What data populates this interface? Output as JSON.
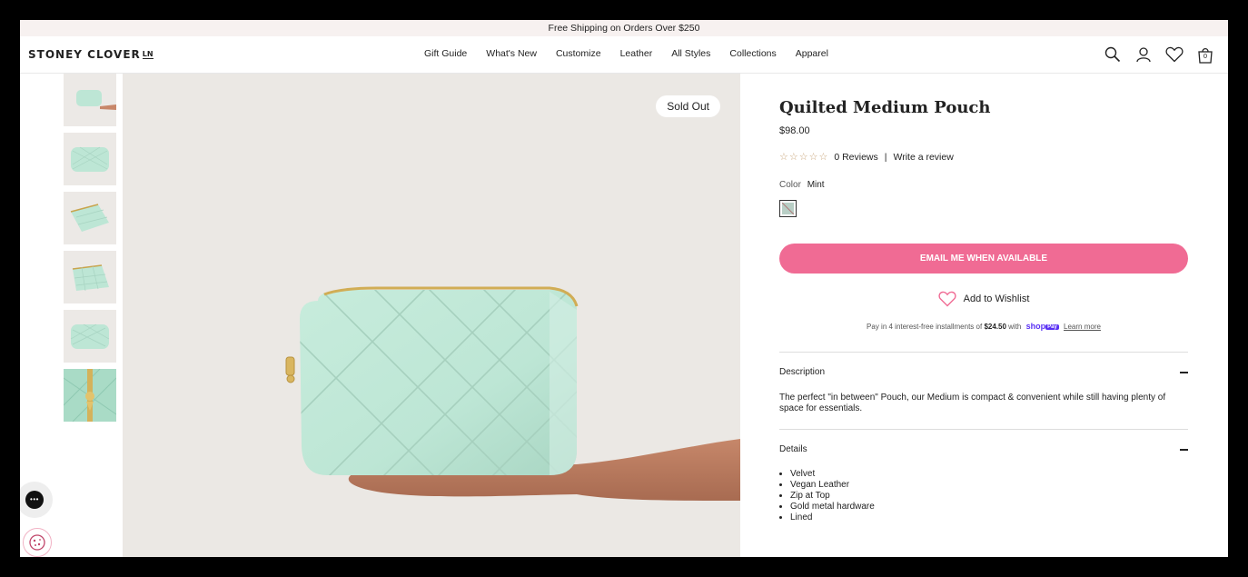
{
  "announcement": "Free Shipping on Orders Over $250",
  "header": {
    "logo": "STONEY CLOVER",
    "logo_suffix": "LN",
    "nav": [
      "Gift Guide",
      "What's New",
      "Customize",
      "Leather",
      "All Styles",
      "Collections",
      "Apparel"
    ],
    "cart_count": "0",
    "icons": [
      "search-icon",
      "account-icon",
      "heart-icon",
      "cart-icon"
    ]
  },
  "gallery": {
    "badge": "Sold Out",
    "thumbnails": [
      "thumb-hand",
      "thumb-front",
      "thumb-open",
      "thumb-angle",
      "thumb-back",
      "thumb-zipper"
    ]
  },
  "product": {
    "title": "Quilted Medium Pouch",
    "price": "$98.00",
    "rating": 0,
    "reviews_label": "0 Reviews",
    "write_review": "Write a review",
    "color_label": "Color",
    "color_value": "Mint",
    "cta": "EMAIL ME WHEN AVAILABLE",
    "wishlist": "Add to Wishlist",
    "installments_prefix": "Pay in 4 interest-free installments of",
    "installment_amount": "$24.50",
    "installments_with": "with",
    "shop_pay": "shop",
    "shop_pay_badge": "Pay",
    "learn_more": "Learn more"
  },
  "description": {
    "heading": "Description",
    "text": "The perfect \"in between\" Pouch, our Medium is compact & convenient while still having plenty of space for essentials."
  },
  "details": {
    "heading": "Details",
    "items": [
      "Velvet",
      "Vegan Leather",
      "Zip at Top",
      "Gold metal hardware",
      "Lined"
    ]
  },
  "colors": {
    "accent": "#f06b94",
    "mint": "#bde6d5",
    "shop_pay": "#5a31f4"
  }
}
